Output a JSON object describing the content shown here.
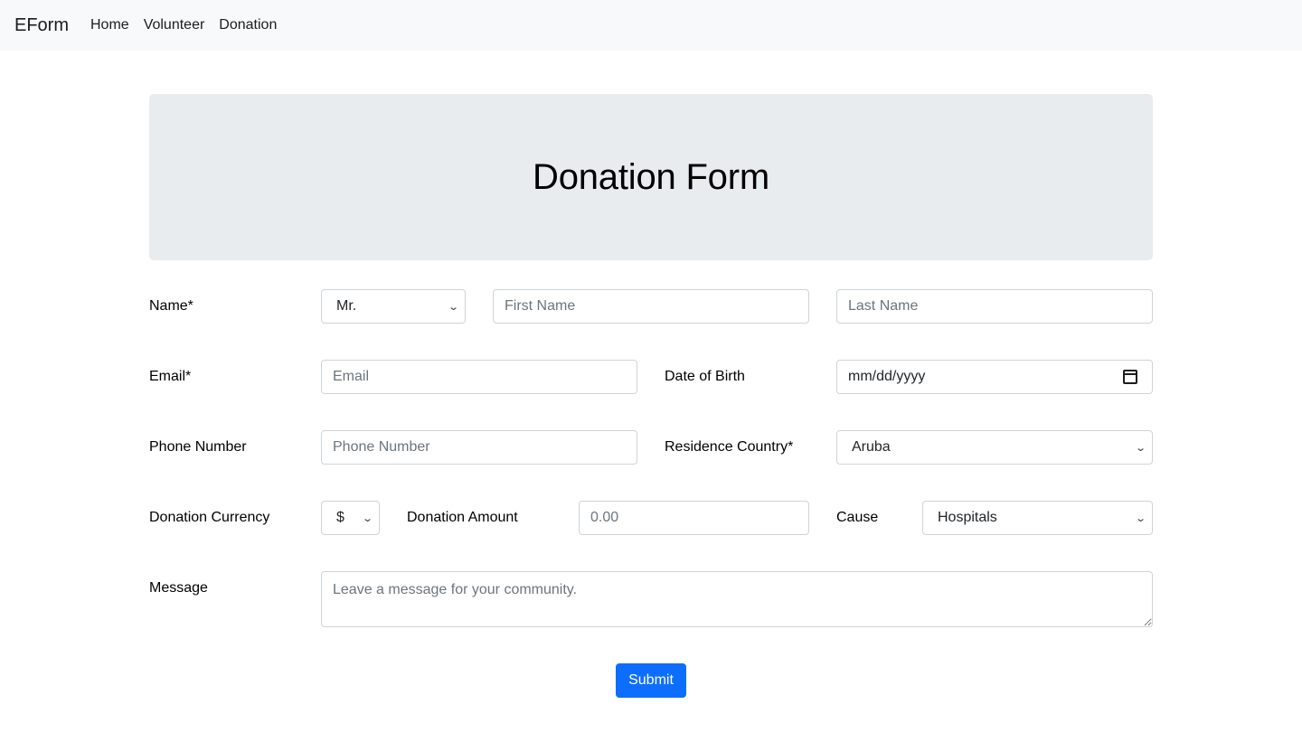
{
  "navbar": {
    "brand": "EForm",
    "links": [
      "Home",
      "Volunteer",
      "Donation"
    ]
  },
  "header": {
    "title": "Donation Form"
  },
  "form": {
    "name": {
      "label": "Name*",
      "salutation": "Mr.",
      "first_placeholder": "First Name",
      "last_placeholder": "Last Name"
    },
    "email": {
      "label": "Email*",
      "placeholder": "Email"
    },
    "dob": {
      "label": "Date of Birth",
      "placeholder": "mm/dd/yyyy"
    },
    "phone": {
      "label": "Phone Number",
      "placeholder": "Phone Number"
    },
    "country": {
      "label": "Residence Country*",
      "value": "Aruba"
    },
    "currency": {
      "label": "Donation Currency",
      "value": "$"
    },
    "amount": {
      "label": "Donation Amount",
      "placeholder": "0.00"
    },
    "cause": {
      "label": "Cause",
      "value": "Hospitals"
    },
    "message": {
      "label": "Message",
      "placeholder": "Leave a message for your community."
    },
    "submit_label": "Submit"
  },
  "colors": {
    "navbar_bg": "#f8f9fa",
    "jumbotron_bg": "#e9ecef",
    "primary": "#0d6efd",
    "input_border": "#ced4da"
  }
}
